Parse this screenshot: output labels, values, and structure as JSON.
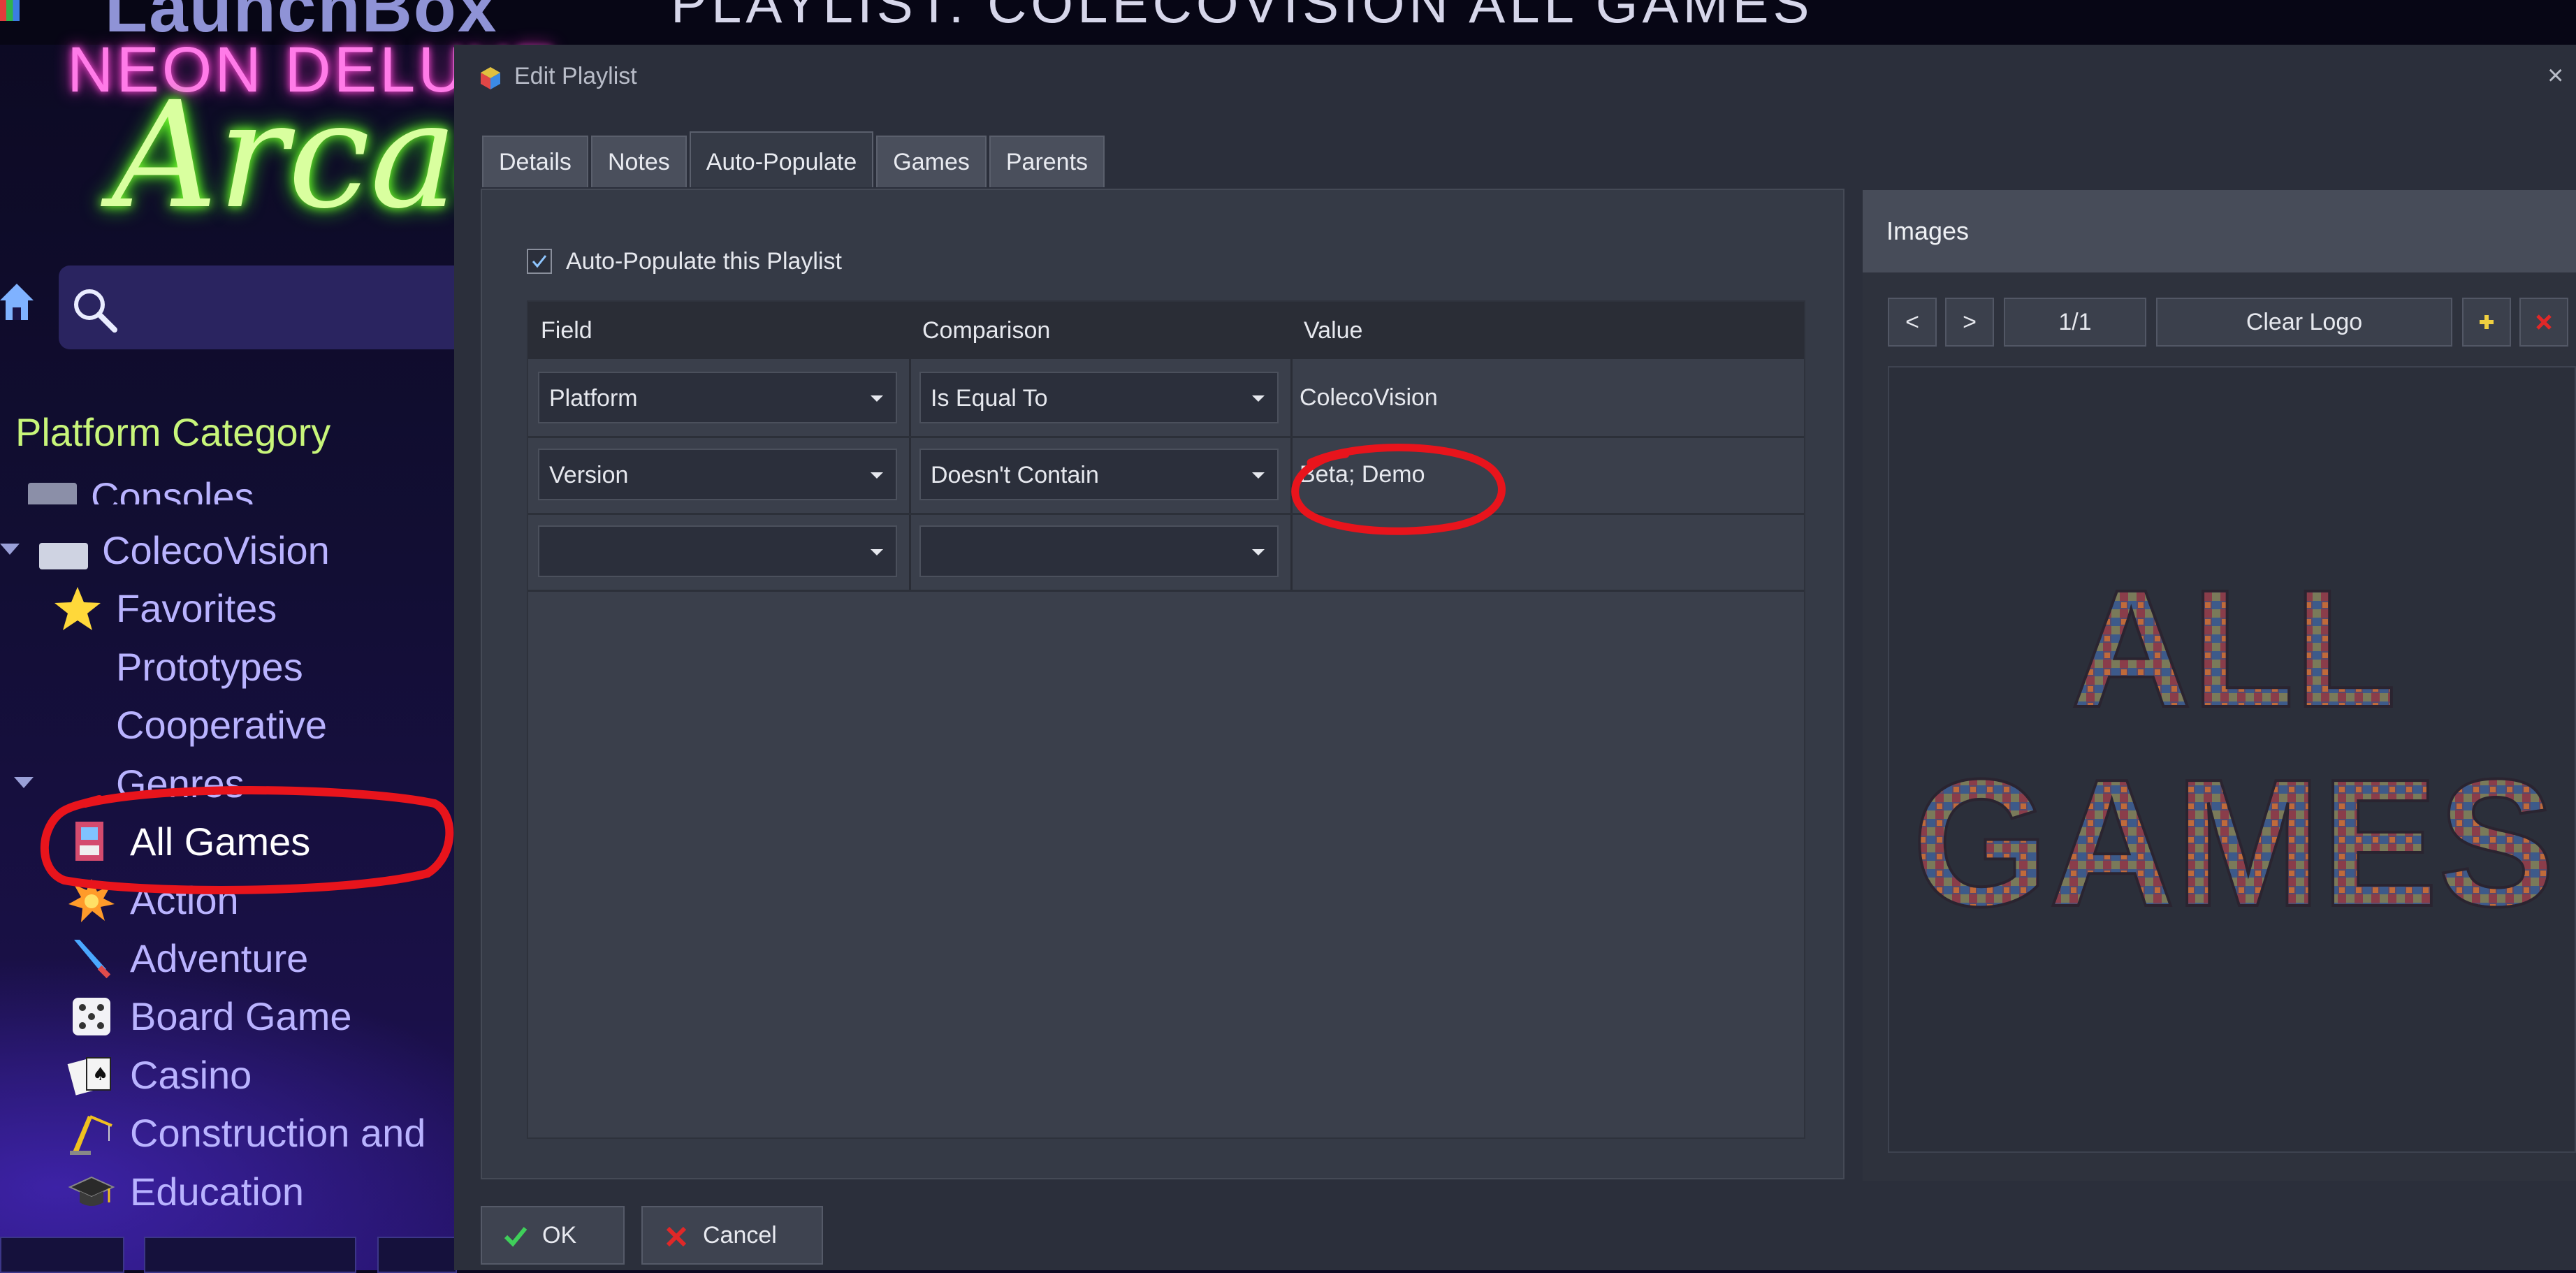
{
  "background_app": {
    "logo_text": "LaunchBox",
    "header_title": "PLAYLIST: COLECOVISION ALL GAMES",
    "theme_text_1": "NEON DELUXE",
    "theme_text_2": "Arcade",
    "sidebar": {
      "heading": "Platform Category",
      "items": [
        {
          "label": "Consoles",
          "icon": "console-icon"
        },
        {
          "label": "ColecoVision",
          "icon": "colecovision-icon"
        },
        {
          "label": "Favorites",
          "icon": "star-icon"
        },
        {
          "label": "Prototypes",
          "icon": ""
        },
        {
          "label": "Cooperative",
          "icon": ""
        },
        {
          "label": "Genres",
          "icon": ""
        },
        {
          "label": "All Games",
          "icon": "all-games-icon",
          "selected": true
        },
        {
          "label": "Action",
          "icon": "explosion-icon"
        },
        {
          "label": "Adventure",
          "icon": "sword-icon"
        },
        {
          "label": "Board Game",
          "icon": "dice-icon"
        },
        {
          "label": "Casino",
          "icon": "cards-icon"
        },
        {
          "label": "Construction and",
          "icon": "crane-icon"
        },
        {
          "label": "Education",
          "icon": "graduation-cap-icon"
        }
      ]
    }
  },
  "dialog": {
    "title": "Edit Playlist",
    "close_glyph": "×",
    "tabs": [
      {
        "label": "Details",
        "active": false
      },
      {
        "label": "Notes",
        "active": false
      },
      {
        "label": "Auto-Populate",
        "active": true
      },
      {
        "label": "Games",
        "active": false
      },
      {
        "label": "Parents",
        "active": false
      }
    ],
    "auto_populate": {
      "checkbox_label": "Auto-Populate this Playlist",
      "checked": true,
      "columns": [
        "Field",
        "Comparison",
        "Value"
      ],
      "rows": [
        {
          "field": "Platform",
          "comparison": "Is Equal To",
          "value": "ColecoVision"
        },
        {
          "field": "Version",
          "comparison": "Doesn't Contain",
          "value": "Beta; Demo"
        },
        {
          "field": "",
          "comparison": "",
          "value": ""
        }
      ]
    },
    "images": {
      "title": "Images",
      "prev_label": "<",
      "next_label": ">",
      "counter": "1/1",
      "clear_label": "Clear Logo",
      "image_text_line1": "ALL",
      "image_text_line2": "GAMES"
    },
    "buttons": {
      "ok_label": "OK",
      "cancel_label": "Cancel"
    }
  },
  "colors": {
    "annotation": "#e8141c",
    "neon_pink": "#ff7be8",
    "neon_green": "#d9ff9f",
    "sidebar_text": "#b9b3ff",
    "heading_green": "#c8f57a"
  }
}
